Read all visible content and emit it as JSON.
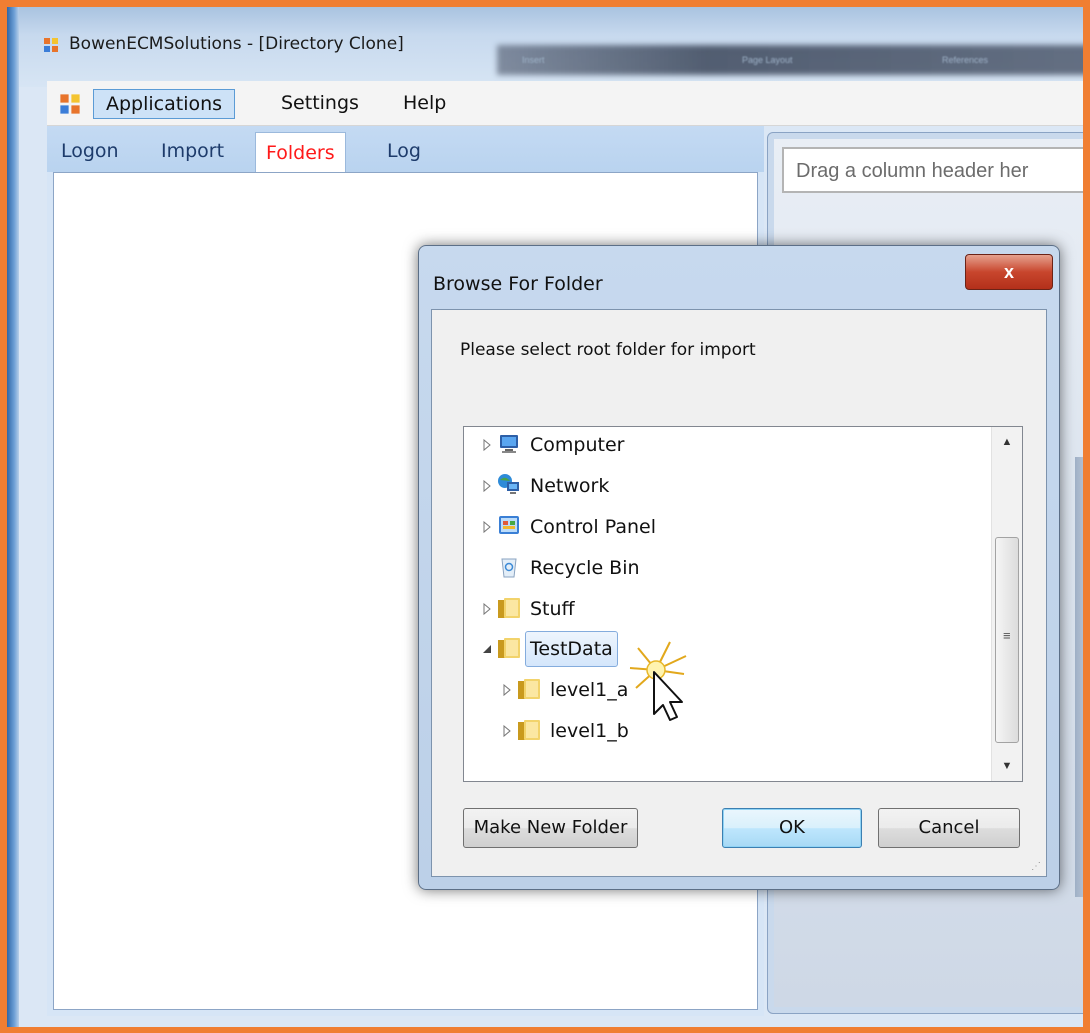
{
  "window": {
    "title": "BowenECMSolutions - [Directory Clone]",
    "blurred_ribbon": [
      "Insert",
      "Page Layout",
      "References"
    ]
  },
  "menubar": {
    "items": [
      "Applications",
      "Settings",
      "Help"
    ]
  },
  "tabs": {
    "items": [
      "Logon",
      "Import",
      "Folders",
      "Log"
    ],
    "selected": "Folders"
  },
  "grid": {
    "group_header_hint": "Drag a column header her"
  },
  "dialog": {
    "title": "Browse For Folder",
    "close_label": "x",
    "prompt": "Please select root folder for import",
    "tree": [
      {
        "label": "Computer",
        "icon": "computer-icon",
        "expander": "collapsed"
      },
      {
        "label": "Network",
        "icon": "network-icon",
        "expander": "collapsed"
      },
      {
        "label": "Control Panel",
        "icon": "control-panel-icon",
        "expander": "collapsed"
      },
      {
        "label": "Recycle Bin",
        "icon": "recycle-bin-icon",
        "expander": "none"
      },
      {
        "label": "Stuff",
        "icon": "folder-icon",
        "expander": "collapsed"
      },
      {
        "label": "TestData",
        "icon": "folder-icon",
        "expander": "expanded",
        "selected": true
      },
      {
        "label": "level1_a",
        "icon": "folder-icon",
        "expander": "collapsed"
      },
      {
        "label": "level1_b",
        "icon": "folder-icon",
        "expander": "collapsed"
      }
    ],
    "buttons": {
      "make_new_folder": "Make New Folder",
      "ok": "OK",
      "cancel": "Cancel"
    }
  },
  "colors": {
    "highlight_border": "#f07e32",
    "selected_tab_text": "#ff1a1a",
    "selection_border": "#84acdd",
    "close_button": "#c8462d"
  }
}
